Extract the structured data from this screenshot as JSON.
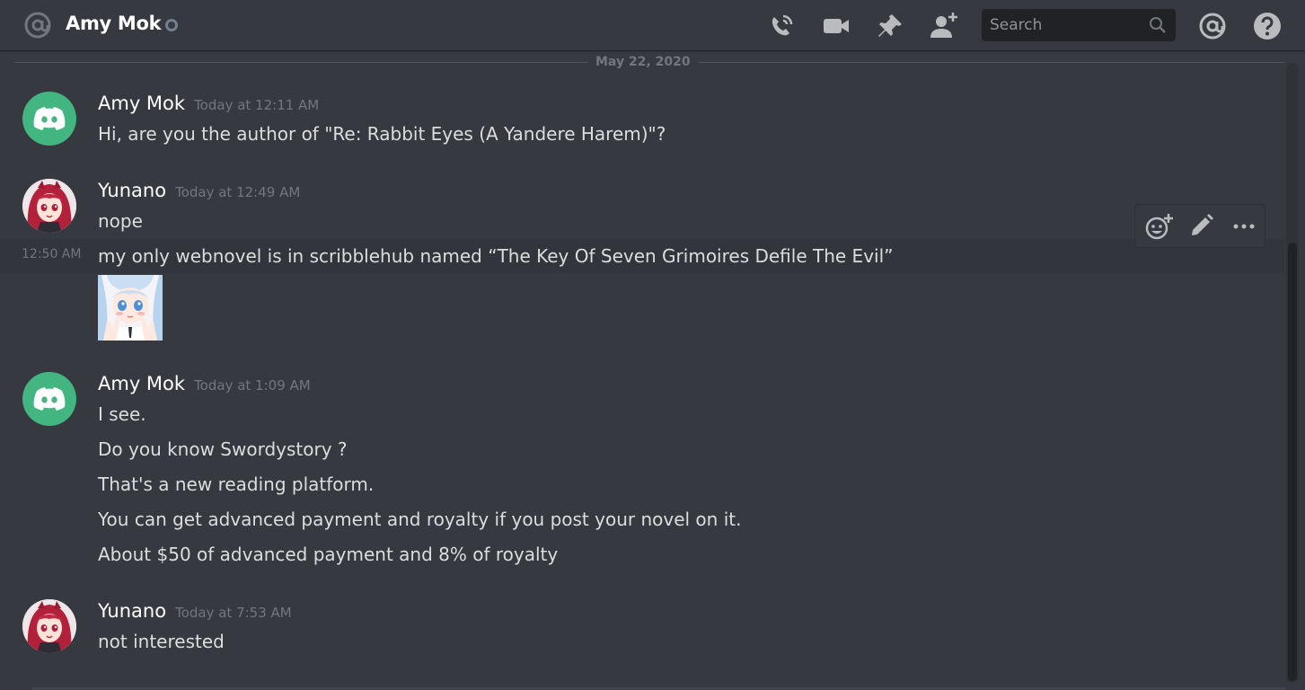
{
  "header": {
    "channel_name": "Amy Mok",
    "search_placeholder": "Search",
    "icons": [
      "at-icon",
      "voice-call-icon",
      "video-call-icon",
      "pin-icon",
      "add-friend-icon",
      "search-icon",
      "mentions-icon",
      "help-icon"
    ]
  },
  "divider": {
    "date": "May 22, 2020"
  },
  "messages": [
    {
      "author": "Amy Mok",
      "timestamp": "Today at 12:11 AM",
      "avatar": "discord-logo-avatar",
      "lines": [
        "Hi, are you the author of \"Re: Rabbit Eyes (A Yandere Harem)\"?"
      ]
    },
    {
      "author": "Yunano",
      "timestamp": "Today at 12:49 AM",
      "avatar": "anime-girl-avatar",
      "lines": [
        "nope"
      ],
      "followup": {
        "timestamp": "12:50 AM",
        "text": "my only webnovel is in scribblehub named “The Key Of Seven Grimoires Defile The Evil”"
      },
      "attachment": "anime-image"
    },
    {
      "author": "Amy Mok",
      "timestamp": "Today at 1:09 AM",
      "avatar": "discord-logo-avatar",
      "lines": [
        "I see.",
        "Do you know Swordystory ?",
        "That's a new reading platform.",
        "You can get advanced payment and royalty if you post your novel on it.",
        "About $50 of advanced payment and 8% of royalty"
      ]
    },
    {
      "author": "Yunano",
      "timestamp": "Today at 7:53 AM",
      "avatar": "anime-girl-avatar",
      "lines": [
        "not interested"
      ]
    }
  ],
  "message_toolbar": {
    "icons": [
      "add-reaction-icon",
      "edit-icon",
      "more-options-icon"
    ]
  },
  "colors": {
    "background": "#36393f",
    "discord_green": "#43b581",
    "text": "#dcddde",
    "muted": "#72767d"
  }
}
